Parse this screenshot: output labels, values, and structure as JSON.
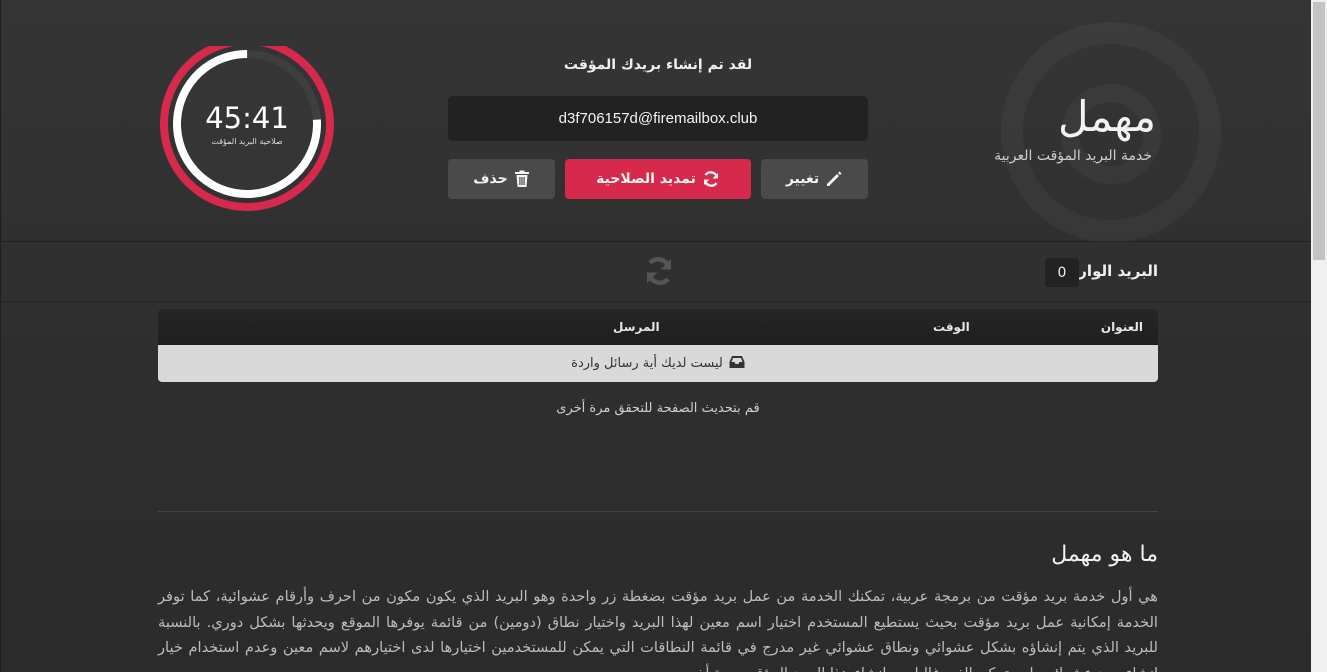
{
  "brand": {
    "logo_text": "مهمل",
    "tagline": "خدمة البريد المؤقت العربية"
  },
  "mailbox": {
    "created_title": "لقد تم إنشاء بريدك المؤقت",
    "email": "d3f706157d@firemailbox.club",
    "change_label": "تغيير",
    "extend_label": "تمديد الصلاحية",
    "delete_label": "حذف"
  },
  "timer": {
    "time": "45:41",
    "label": "صلاحية البريد المؤقت",
    "progress": 0.76,
    "ring_color": "#d6294b",
    "progress_color": "#ffffff"
  },
  "inbox": {
    "label": "البريد الوارد",
    "count": "0"
  },
  "table": {
    "columns": {
      "title": "العنوان",
      "time": "الوقت",
      "sender": "المرسل"
    },
    "empty_message": "ليست لديك أية رسائل واردة",
    "refresh_hint": "قم بتحديث الصفحة للتحقق مرة أخرى"
  },
  "about": {
    "title": "ما هو مهمل",
    "text": "هي أول خدمة بريد مؤقت من برمجة عربية، تمكنك الخدمة من عمل بريد مؤقت بضغطة زر واحدة وهو البريد الذي يكون مكون من احرف وأرقام عشوائية، كما توفر الخدمة إمكانية عمل بريد مؤقت بحيث يستطيع المستخدم اختيار اسم معين لهذا البريد واختيار نطاق (دومين) من قائمة يوفرها الموقع ويحدثها بشكل دوري. بالنسبة للبريد الذي يتم إنشاؤه بشكل عشوائي ونطاق عشوائي غير مدرج في قائمة النطاقات التي يمكن للمستخدمين اختيارها لدى اختيارهم لاسم معين وعدم استخدام خيار إنشاء بريد عشوائي، لن يتمكن الغير غالبا من إنشاء هذا البريد المؤقت مرة أخرى"
  },
  "colors": {
    "accent": "#d6294b",
    "background": "#2f2f2f"
  },
  "icons": {
    "change": "pencil-icon",
    "extend": "refresh-icon",
    "delete": "trash-icon",
    "inbox_refresh": "refresh-icon",
    "empty": "inbox-tray-icon"
  }
}
